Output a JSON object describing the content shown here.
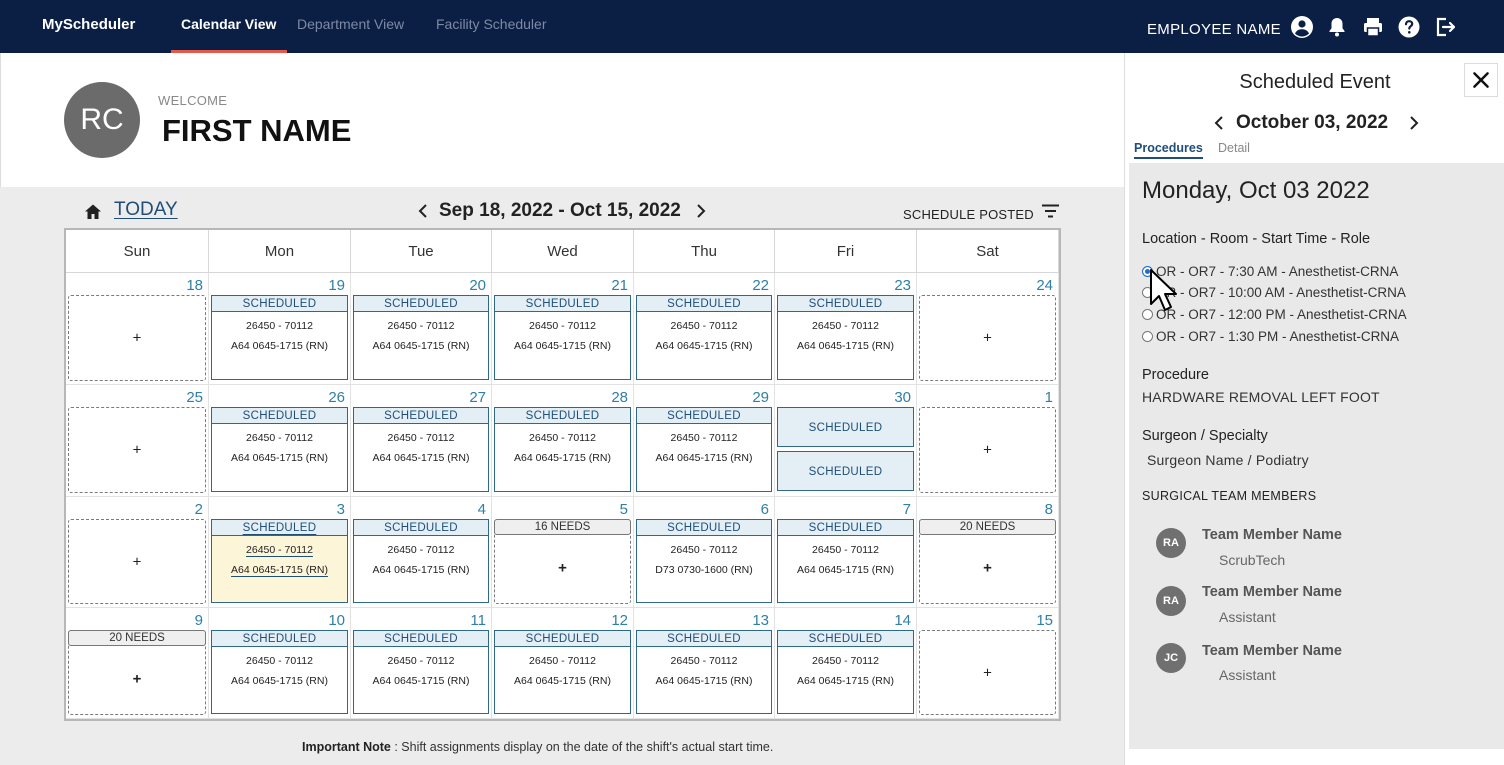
{
  "nav": {
    "brand": "MyScheduler",
    "links": [
      "Calendar View",
      "Department View",
      "Facility Scheduler"
    ],
    "employee": "EMPLOYEE NAME",
    "icons": [
      "account-icon",
      "bell-icon",
      "print-icon",
      "help-icon",
      "logout-icon"
    ]
  },
  "welcome": {
    "initials": "RC",
    "label": "WELCOME",
    "name": "FIRST NAME"
  },
  "calendar": {
    "today_label": "TODAY",
    "range": "Sep 18, 2022 - Oct 15, 2022",
    "status": "SCHEDULE POSTED",
    "days": [
      "Sun",
      "Mon",
      "Tue",
      "Wed",
      "Thu",
      "Fri",
      "Sat"
    ],
    "weeks": [
      [
        {
          "day": "18",
          "type": "empty"
        },
        {
          "day": "19",
          "type": "scheduled",
          "l1": "26450 - 70112",
          "l2": "A64 0645-1715 (RN)"
        },
        {
          "day": "20",
          "type": "scheduled",
          "l1": "26450 - 70112",
          "l2": "A64 0645-1715 (RN)"
        },
        {
          "day": "21",
          "type": "scheduled",
          "l1": "26450 - 70112",
          "l2": "A64 0645-1715 (RN)"
        },
        {
          "day": "22",
          "type": "scheduled",
          "l1": "26450 - 70112",
          "l2": "A64 0645-1715 (RN)"
        },
        {
          "day": "23",
          "type": "scheduled",
          "l1": "26450 - 70112",
          "l2": "A64 0645-1715 (RN)"
        },
        {
          "day": "24",
          "type": "empty"
        }
      ],
      [
        {
          "day": "25",
          "type": "empty"
        },
        {
          "day": "26",
          "type": "scheduled",
          "l1": "26450 - 70112",
          "l2": "A64 0645-1715 (RN)"
        },
        {
          "day": "27",
          "type": "scheduled",
          "l1": "26450 - 70112",
          "l2": "A64 0645-1715 (RN)"
        },
        {
          "day": "28",
          "type": "scheduled",
          "l1": "26450 - 70112",
          "l2": "A64 0645-1715 (RN)"
        },
        {
          "day": "29",
          "type": "scheduled",
          "l1": "26450 - 70112",
          "l2": "A64 0645-1715 (RN)"
        },
        {
          "day": "30",
          "type": "split"
        },
        {
          "day": "1",
          "type": "empty"
        }
      ],
      [
        {
          "day": "2",
          "type": "empty"
        },
        {
          "day": "3",
          "type": "scheduled",
          "today": true,
          "l1": "26450 - 70112",
          "l2": "A64 0645-1715 (RN)"
        },
        {
          "day": "4",
          "type": "scheduled",
          "l1": "26450 - 70112",
          "l2": "A64 0645-1715 (RN)"
        },
        {
          "day": "5",
          "type": "needs",
          "label": "16 NEEDS"
        },
        {
          "day": "6",
          "type": "scheduled",
          "l1": "26450 - 70112",
          "l2": "D73 0730-1600 (RN)"
        },
        {
          "day": "7",
          "type": "scheduled",
          "l1": "26450 - 70112",
          "l2": "A64 0645-1715 (RN)"
        },
        {
          "day": "8",
          "type": "needs",
          "label": "20 NEEDS"
        }
      ],
      [
        {
          "day": "9",
          "type": "needs",
          "label": "20 NEEDS"
        },
        {
          "day": "10",
          "type": "scheduled",
          "l1": "26450 - 70112",
          "l2": "A64 0645-1715 (RN)"
        },
        {
          "day": "11",
          "type": "scheduled",
          "l1": "26450 - 70112",
          "l2": "A64 0645-1715 (RN)"
        },
        {
          "day": "12",
          "type": "scheduled",
          "l1": "26450 - 70112",
          "l2": "A64 0645-1715 (RN)"
        },
        {
          "day": "13",
          "type": "scheduled",
          "l1": "26450 - 70112",
          "l2": "A64 0645-1715 (RN)"
        },
        {
          "day": "14",
          "type": "scheduled",
          "l1": "26450 - 70112",
          "l2": "A64 0645-1715 (RN)"
        },
        {
          "day": "15",
          "type": "empty"
        }
      ]
    ],
    "scheduled_label": "SCHEDULED",
    "plus": "+"
  },
  "note": {
    "bold": "Important Note",
    "text": " : Shift assignments display on the date of the shift's actual start time."
  },
  "panel": {
    "title": "Scheduled Event",
    "close": "✕",
    "date": "October 03, 2022",
    "tabs": [
      "Procedures",
      "Detail"
    ],
    "day_heading": "Monday, Oct 03 2022",
    "options_label": "Location - Room - Start Time - Role",
    "options": [
      "OR - OR7 - 7:30 AM - Anesthetist-CRNA",
      "OR - OR7 - 10:00 AM - Anesthetist-CRNA",
      "OR - OR7 - 12:00 PM - Anesthetist-CRNA",
      "OR - OR7 - 1:30 PM - Anesthetist-CRNA"
    ],
    "selected_option": 0,
    "procedure_label": "Procedure",
    "procedure": "HARDWARE REMOVAL LEFT FOOT",
    "surgeon_label": "Surgeon / Specialty",
    "surgeon": "Surgeon Name / Podiatry",
    "team_label": "SURGICAL TEAM MEMBERS",
    "team": [
      {
        "initials": "RA",
        "name": "Team Member Name",
        "role": "ScrubTech"
      },
      {
        "initials": "RA",
        "name": "Team Member Name",
        "role": "Assistant"
      },
      {
        "initials": "JC",
        "name": "Team Member Name",
        "role": "Assistant"
      }
    ]
  }
}
